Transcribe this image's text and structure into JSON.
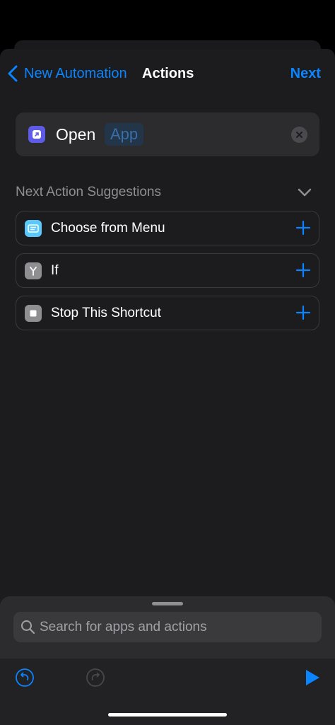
{
  "nav": {
    "back_label": "New Automation",
    "title": "Actions",
    "next_label": "Next"
  },
  "action": {
    "verb": "Open",
    "parameter": "App",
    "icon": "open-app-icon"
  },
  "suggestions": {
    "header": "Next Action Suggestions",
    "items": [
      {
        "label": "Choose from Menu",
        "icon": "menu-icon",
        "color": "#5ac8fa"
      },
      {
        "label": "If",
        "icon": "branch-icon",
        "color": "#8e8e93"
      },
      {
        "label": "Stop This Shortcut",
        "icon": "stop-icon",
        "color": "#8e8e93"
      }
    ]
  },
  "search": {
    "placeholder": "Search for apps and actions"
  },
  "colors": {
    "accent": "#0a84ff",
    "background": "#1c1c1e",
    "card": "#2c2c2e"
  }
}
